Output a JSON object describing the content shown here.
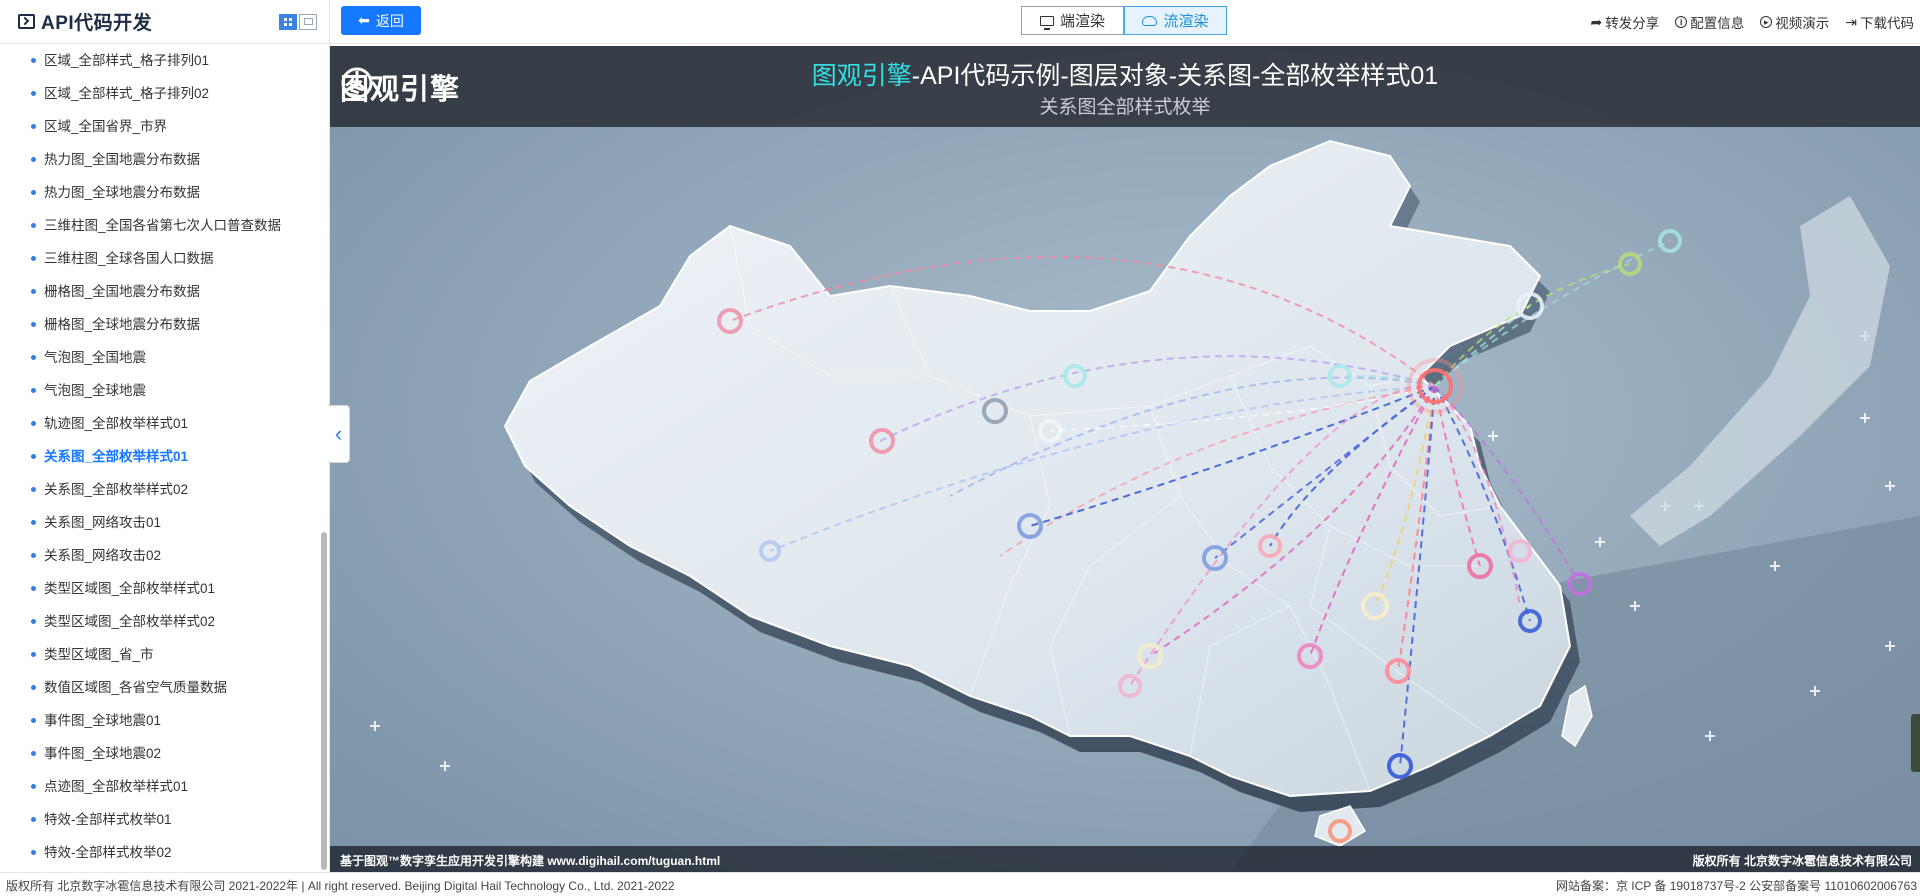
{
  "sidebar": {
    "title": "API代码开发",
    "menu": [
      {
        "label": "区域_全部样式_格子排列01"
      },
      {
        "label": "区域_全部样式_格子排列02"
      },
      {
        "label": "区域_全国省界_市界"
      },
      {
        "label": "热力图_全国地震分布数据"
      },
      {
        "label": "热力图_全球地震分布数据"
      },
      {
        "label": "三维柱图_全国各省第七次人口普查数据"
      },
      {
        "label": "三维柱图_全球各国人口数据"
      },
      {
        "label": "栅格图_全国地震分布数据"
      },
      {
        "label": "栅格图_全球地震分布数据"
      },
      {
        "label": "气泡图_全国地震"
      },
      {
        "label": "气泡图_全球地震"
      },
      {
        "label": "轨迹图_全部枚举样式01"
      },
      {
        "label": "关系图_全部枚举样式01",
        "active": true
      },
      {
        "label": "关系图_全部枚举样式02"
      },
      {
        "label": "关系图_网络攻击01"
      },
      {
        "label": "关系图_网络攻击02"
      },
      {
        "label": "类型区域图_全部枚举样式01"
      },
      {
        "label": "类型区域图_全部枚举样式02"
      },
      {
        "label": "类型区域图_省_市"
      },
      {
        "label": "数值区域图_各省空气质量数据"
      },
      {
        "label": "事件图_全球地震01"
      },
      {
        "label": "事件图_全球地震02"
      },
      {
        "label": "点迹图_全部枚举样式01"
      },
      {
        "label": "特效-全部样式枚举01"
      },
      {
        "label": "特效-全部样式枚举02"
      }
    ]
  },
  "topbar": {
    "back_label": "返回",
    "render_tabs": [
      {
        "label": "端渲染",
        "icon": "monitor-icon"
      },
      {
        "label": "流渲染",
        "icon": "cloud-icon",
        "active": true
      }
    ],
    "actions": [
      {
        "name": "share",
        "label": "转发分享",
        "icon": "share-icon"
      },
      {
        "name": "config",
        "label": "配置信息",
        "icon": "info-icon"
      },
      {
        "name": "video",
        "label": "视频演示",
        "icon": "play-icon"
      },
      {
        "name": "download",
        "label": "下载代码",
        "icon": "download-icon"
      }
    ]
  },
  "scene": {
    "logo_text": "图观引擎",
    "title_highlight": "图观引擎",
    "title_rest": "-API代码示例-图层对象-关系图-全部枚举样式01",
    "subtitle": "关系图全部样式枚举",
    "footer_left": "基于图观™数字孪生应用开发引擎构建 www.digihail.com/tuguan.html",
    "footer_right": "版权所有 北京数字冰雹信息技术有限公司"
  },
  "bottombar": {
    "copyright": "版权所有 北京数字冰雹信息技术有限公司 2021-2022年 | All right reserved. Beijing Digital Hail Technology Co., Ltd. 2021-2022",
    "icp": "网站备案：京 ICP 备 19018737号-2 公安部备案号 11010602006763"
  },
  "colors": {
    "accent": "#1677ff",
    "title_highlight": "#33e0e3",
    "active_tab_bg": "#e6f3ff"
  }
}
